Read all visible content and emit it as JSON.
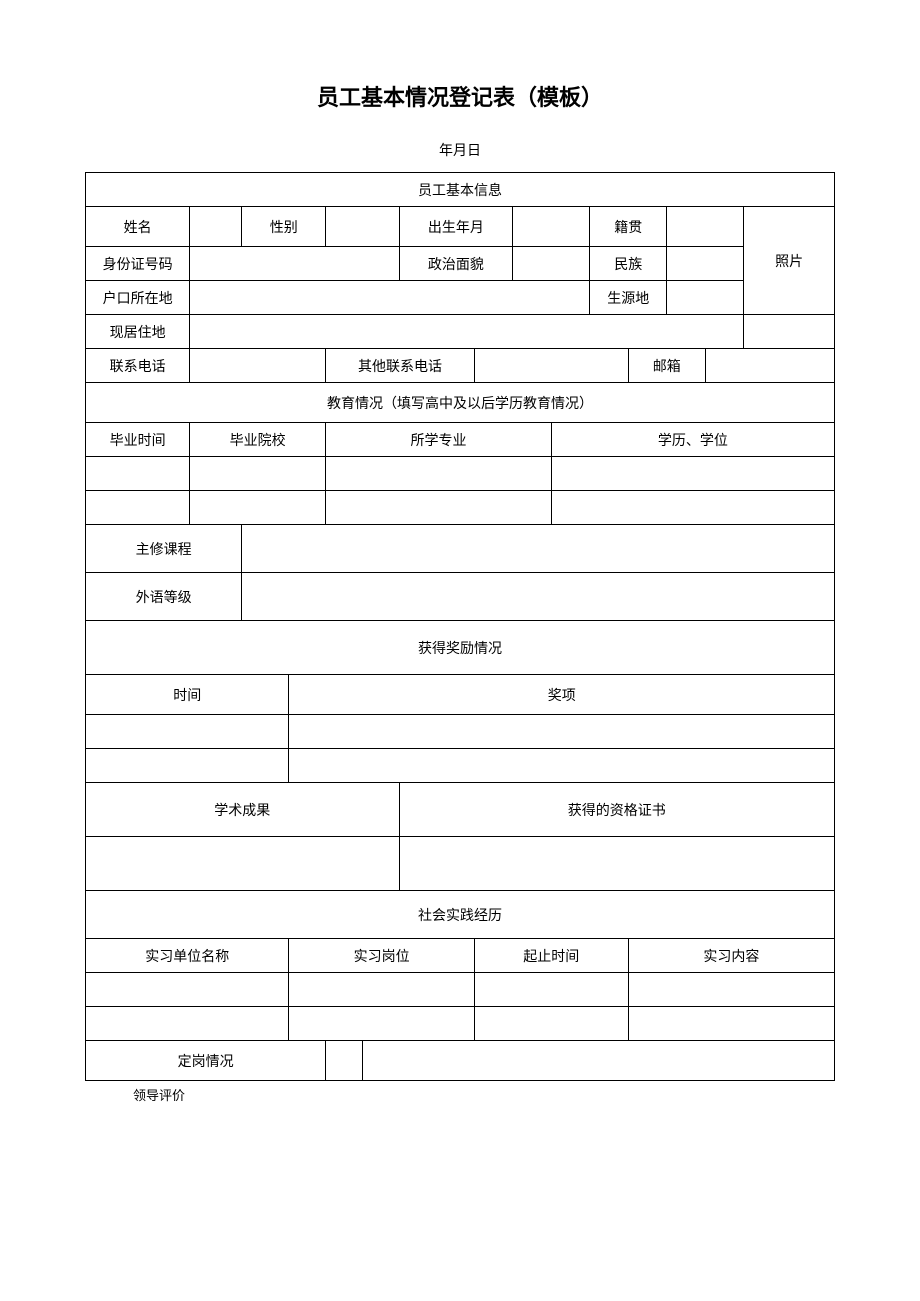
{
  "title": "员工基本情况登记表（模板）",
  "dateLine": "年月日",
  "section": {
    "basic": "员工基本信息",
    "name": "姓名",
    "gender": "性别",
    "birth": "出生年月",
    "nativePlace": "籍贯",
    "idNo": "身份证号码",
    "political": "政治面貌",
    "ethnicity": "民族",
    "photo": "照片",
    "hukou": "户口所在地",
    "origin": "生源地",
    "residence": "现居住地",
    "phone": "联系电话",
    "otherPhone": "其他联系电话",
    "email": "邮箱",
    "education": "教育情况（填写高中及以后学历教育情况）",
    "gradTime": "毕业时间",
    "gradSchool": "毕业院校",
    "major": "所学专业",
    "degree": "学历、学位",
    "mainCourse": "主修课程",
    "langLevel": "外语等级",
    "awards": "获得奖励情况",
    "time": "时间",
    "awardItem": "奖项",
    "academic": "学术成果",
    "certificate": "获得的资格证书",
    "social": "社会实践经历",
    "internOrg": "实习单位名称",
    "internPos": "实习岗位",
    "internPeriod": "起止时间",
    "internContent": "实习内容",
    "postStatus": "定岗情况",
    "leaderEval": "领导评价"
  }
}
